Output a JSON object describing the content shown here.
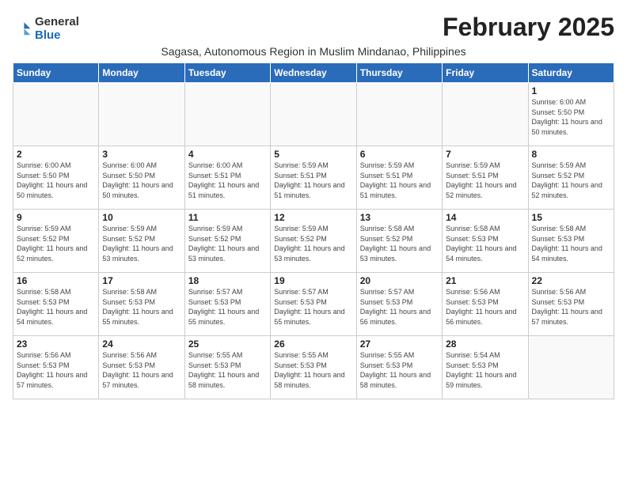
{
  "logo": {
    "line1": "General",
    "line2": "Blue"
  },
  "title": "February 2025",
  "subtitle": "Sagasa, Autonomous Region in Muslim Mindanao, Philippines",
  "days_of_week": [
    "Sunday",
    "Monday",
    "Tuesday",
    "Wednesday",
    "Thursday",
    "Friday",
    "Saturday"
  ],
  "weeks": [
    [
      {
        "day": "",
        "info": ""
      },
      {
        "day": "",
        "info": ""
      },
      {
        "day": "",
        "info": ""
      },
      {
        "day": "",
        "info": ""
      },
      {
        "day": "",
        "info": ""
      },
      {
        "day": "",
        "info": ""
      },
      {
        "day": "1",
        "info": "Sunrise: 6:00 AM\nSunset: 5:50 PM\nDaylight: 11 hours\nand 50 minutes."
      }
    ],
    [
      {
        "day": "2",
        "info": "Sunrise: 6:00 AM\nSunset: 5:50 PM\nDaylight: 11 hours\nand 50 minutes."
      },
      {
        "day": "3",
        "info": "Sunrise: 6:00 AM\nSunset: 5:50 PM\nDaylight: 11 hours\nand 50 minutes."
      },
      {
        "day": "4",
        "info": "Sunrise: 6:00 AM\nSunset: 5:51 PM\nDaylight: 11 hours\nand 51 minutes."
      },
      {
        "day": "5",
        "info": "Sunrise: 5:59 AM\nSunset: 5:51 PM\nDaylight: 11 hours\nand 51 minutes."
      },
      {
        "day": "6",
        "info": "Sunrise: 5:59 AM\nSunset: 5:51 PM\nDaylight: 11 hours\nand 51 minutes."
      },
      {
        "day": "7",
        "info": "Sunrise: 5:59 AM\nSunset: 5:51 PM\nDaylight: 11 hours\nand 52 minutes."
      },
      {
        "day": "8",
        "info": "Sunrise: 5:59 AM\nSunset: 5:52 PM\nDaylight: 11 hours\nand 52 minutes."
      }
    ],
    [
      {
        "day": "9",
        "info": "Sunrise: 5:59 AM\nSunset: 5:52 PM\nDaylight: 11 hours\nand 52 minutes."
      },
      {
        "day": "10",
        "info": "Sunrise: 5:59 AM\nSunset: 5:52 PM\nDaylight: 11 hours\nand 53 minutes."
      },
      {
        "day": "11",
        "info": "Sunrise: 5:59 AM\nSunset: 5:52 PM\nDaylight: 11 hours\nand 53 minutes."
      },
      {
        "day": "12",
        "info": "Sunrise: 5:59 AM\nSunset: 5:52 PM\nDaylight: 11 hours\nand 53 minutes."
      },
      {
        "day": "13",
        "info": "Sunrise: 5:58 AM\nSunset: 5:52 PM\nDaylight: 11 hours\nand 53 minutes."
      },
      {
        "day": "14",
        "info": "Sunrise: 5:58 AM\nSunset: 5:53 PM\nDaylight: 11 hours\nand 54 minutes."
      },
      {
        "day": "15",
        "info": "Sunrise: 5:58 AM\nSunset: 5:53 PM\nDaylight: 11 hours\nand 54 minutes."
      }
    ],
    [
      {
        "day": "16",
        "info": "Sunrise: 5:58 AM\nSunset: 5:53 PM\nDaylight: 11 hours\nand 54 minutes."
      },
      {
        "day": "17",
        "info": "Sunrise: 5:58 AM\nSunset: 5:53 PM\nDaylight: 11 hours\nand 55 minutes."
      },
      {
        "day": "18",
        "info": "Sunrise: 5:57 AM\nSunset: 5:53 PM\nDaylight: 11 hours\nand 55 minutes."
      },
      {
        "day": "19",
        "info": "Sunrise: 5:57 AM\nSunset: 5:53 PM\nDaylight: 11 hours\nand 55 minutes."
      },
      {
        "day": "20",
        "info": "Sunrise: 5:57 AM\nSunset: 5:53 PM\nDaylight: 11 hours\nand 56 minutes."
      },
      {
        "day": "21",
        "info": "Sunrise: 5:56 AM\nSunset: 5:53 PM\nDaylight: 11 hours\nand 56 minutes."
      },
      {
        "day": "22",
        "info": "Sunrise: 5:56 AM\nSunset: 5:53 PM\nDaylight: 11 hours\nand 57 minutes."
      }
    ],
    [
      {
        "day": "23",
        "info": "Sunrise: 5:56 AM\nSunset: 5:53 PM\nDaylight: 11 hours\nand 57 minutes."
      },
      {
        "day": "24",
        "info": "Sunrise: 5:56 AM\nSunset: 5:53 PM\nDaylight: 11 hours\nand 57 minutes."
      },
      {
        "day": "25",
        "info": "Sunrise: 5:55 AM\nSunset: 5:53 PM\nDaylight: 11 hours\nand 58 minutes."
      },
      {
        "day": "26",
        "info": "Sunrise: 5:55 AM\nSunset: 5:53 PM\nDaylight: 11 hours\nand 58 minutes."
      },
      {
        "day": "27",
        "info": "Sunrise: 5:55 AM\nSunset: 5:53 PM\nDaylight: 11 hours\nand 58 minutes."
      },
      {
        "day": "28",
        "info": "Sunrise: 5:54 AM\nSunset: 5:53 PM\nDaylight: 11 hours\nand 59 minutes."
      },
      {
        "day": "",
        "info": ""
      }
    ]
  ]
}
